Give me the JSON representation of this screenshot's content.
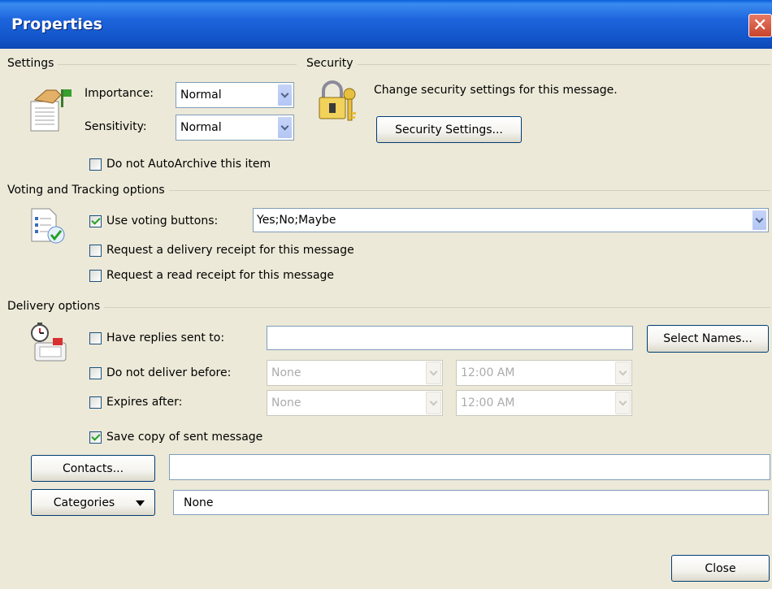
{
  "window": {
    "title": "Properties",
    "close_glyph": "✕"
  },
  "settings": {
    "section_label": "Settings",
    "importance_label": "Importance:",
    "importance_value": "Normal",
    "sensitivity_label": "Sensitivity:",
    "sensitivity_value": "Normal",
    "autoarchive_label": "Do not AutoArchive this item",
    "autoarchive_checked": false,
    "icon": "hand-flag-icon"
  },
  "security": {
    "section_label": "Security",
    "description": "Change security settings for this message.",
    "button_label": "Security Settings...",
    "icon": "padlock-key-icon"
  },
  "voting": {
    "section_label": "Voting and Tracking options",
    "use_voting_label": "Use voting buttons:",
    "use_voting_checked": true,
    "voting_value": "Yes;No;Maybe",
    "delivery_receipt_label": "Request a delivery receipt for this message",
    "delivery_receipt_checked": false,
    "read_receipt_label": "Request a read receipt for this message",
    "read_receipt_checked": false,
    "icon": "checklist-icon"
  },
  "delivery": {
    "section_label": "Delivery options",
    "replies_label": "Have replies sent to:",
    "replies_checked": false,
    "replies_value": "",
    "select_names_label": "Select Names...",
    "not_before_label": "Do not deliver before:",
    "not_before_checked": false,
    "not_before_date": "None",
    "not_before_time": "12:00 AM",
    "expires_label": "Expires after:",
    "expires_checked": false,
    "expires_date": "None",
    "expires_time": "12:00 AM",
    "save_copy_label": "Save copy of sent message",
    "save_copy_checked": true,
    "icon": "timer-mailbox-icon"
  },
  "contacts": {
    "button_label": "Contacts...",
    "value": ""
  },
  "categories": {
    "button_label": "Categories",
    "value": "None"
  },
  "footer": {
    "close_label": "Close"
  }
}
